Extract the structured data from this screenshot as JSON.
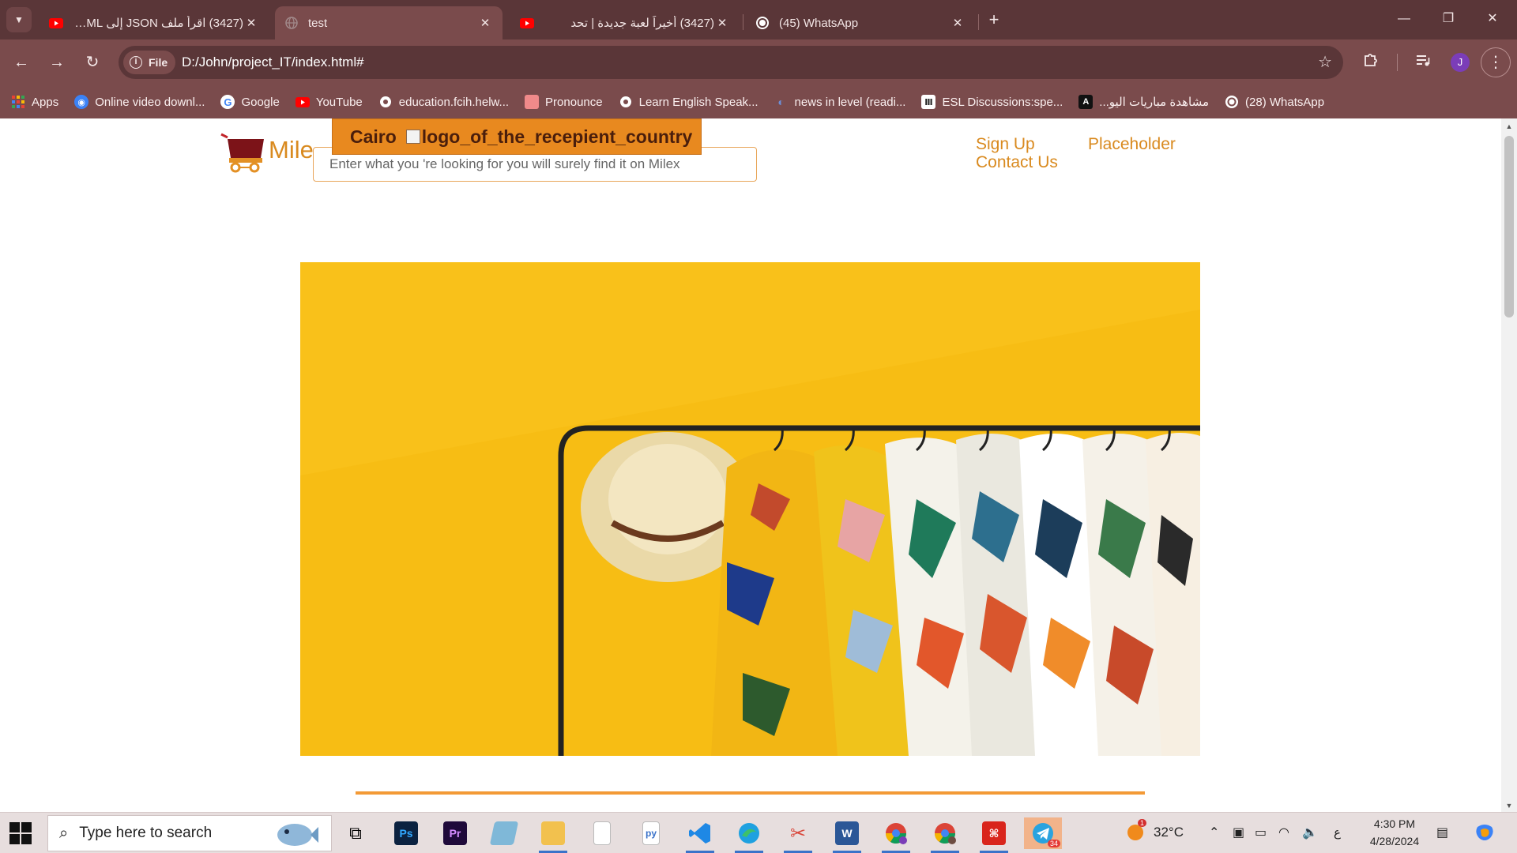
{
  "browser": {
    "tabs": [
      {
        "title": "(3427) اقرأ ملف JSON إلى HTML",
        "favicon": "youtube-icon",
        "active": false
      },
      {
        "title": "test",
        "favicon": "globe-icon",
        "active": true
      },
      {
        "title": "(3427) أخيراً لعبة جديدة | تحد",
        "favicon": "youtube-icon",
        "active": false
      },
      {
        "title": "(45) WhatsApp",
        "favicon": "whatsapp-icon",
        "active": false
      }
    ],
    "close_glyph": "✕",
    "new_tab_glyph": "+",
    "address": {
      "chip_label": "File",
      "url": "D:/John/project_IT/index.html#"
    },
    "profile_initial": "J",
    "bookmarks": [
      {
        "label": "Apps",
        "icon": "apps-grid-icon",
        "color": "#e94235"
      },
      {
        "label": "Online video downl...",
        "icon": "video-download-icon",
        "color": "#3b82f6"
      },
      {
        "label": "Google",
        "icon": "google-icon",
        "color": "#ffffff"
      },
      {
        "label": "YouTube",
        "icon": "youtube-icon",
        "color": "#ff0000"
      },
      {
        "label": "education.fcih.helw...",
        "icon": "globe-icon",
        "color": "#ffffff"
      },
      {
        "label": "Pronounce",
        "icon": "pronounce-icon",
        "color": "#f08a8a"
      },
      {
        "label": "Learn English Speak...",
        "icon": "globe-icon",
        "color": "#ffffff"
      },
      {
        "label": "news in level (readi...",
        "icon": "news-icon",
        "color": "#4f6fb0"
      },
      {
        "label": "ESL Discussions:spe...",
        "icon": "esl-icon",
        "color": "#222222"
      },
      {
        "label": "مشاهدة مباريات اليو...",
        "icon": "sports-icon",
        "color": "#111111"
      },
      {
        "label": "(28) WhatsApp",
        "icon": "whatsapp-icon",
        "color": "#25d366"
      }
    ]
  },
  "page": {
    "brand": "Mile",
    "location": {
      "city": "Cairo",
      "image_alt": "logo_of_the_recepient_country"
    },
    "search": {
      "placeholder": "Enter what you 're looking for you will surely find it on Milex"
    },
    "nav": {
      "sign_up": "Sign Up",
      "placeholder": "Placeholder",
      "contact": "Contact Us"
    },
    "accent_color": "#d98a1f",
    "hero_background": "#f7bd14"
  },
  "taskbar": {
    "search_placeholder": "Type here to search",
    "apps": [
      {
        "name": "task-view-icon",
        "label": ""
      },
      {
        "name": "photoshop-icon",
        "label": "Ps"
      },
      {
        "name": "premiere-icon",
        "label": "Pr"
      },
      {
        "name": "notes-app-icon",
        "label": ""
      },
      {
        "name": "file-explorer-icon",
        "label": ""
      },
      {
        "name": "blank-document-icon",
        "label": ""
      },
      {
        "name": "python-file-icon",
        "label": ""
      },
      {
        "name": "vscode-icon",
        "label": ""
      },
      {
        "name": "edge-icon",
        "label": ""
      },
      {
        "name": "snipping-tool-icon",
        "label": ""
      },
      {
        "name": "word-icon",
        "label": "W"
      },
      {
        "name": "chrome-profile-j-icon",
        "label": ""
      },
      {
        "name": "chrome-profile-m-icon",
        "label": ""
      },
      {
        "name": "acrobat-icon",
        "label": ""
      },
      {
        "name": "telegram-icon",
        "label": ""
      }
    ],
    "telegram_badge": "34",
    "weather": {
      "temp": "32°C",
      "badge": "1"
    },
    "input_lang": "ع",
    "clock": {
      "time": "4:30 PM",
      "date": "4/28/2024"
    }
  }
}
